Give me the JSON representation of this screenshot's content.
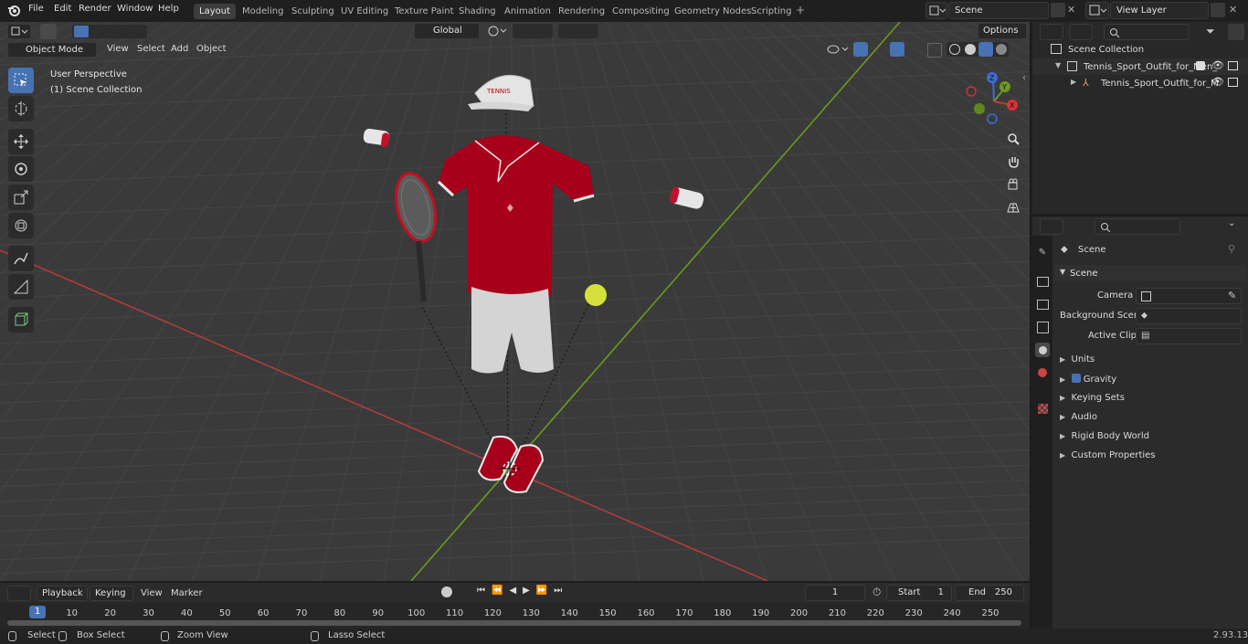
{
  "app": {
    "name": "Blender",
    "version": "2.93.13"
  },
  "menu": {
    "file": "File",
    "edit": "Edit",
    "render": "Render",
    "window": "Window",
    "help": "Help"
  },
  "workspaces": [
    "Layout",
    "Modeling",
    "Sculpting",
    "UV Editing",
    "Texture Paint",
    "Shading",
    "Animation",
    "Rendering",
    "Compositing",
    "Geometry Nodes",
    "Scripting"
  ],
  "active_workspace": "Layout",
  "scene_field": "Scene",
  "view_layer_field": "View Layer",
  "viewport": {
    "mode": "Object Mode",
    "menus": {
      "view": "View",
      "select": "Select",
      "add": "Add",
      "object": "Object"
    },
    "transform_orientation": "Global",
    "options": "Options",
    "overlay_line1": "User Perspective",
    "overlay_line2": "(1) Scene Collection",
    "gizmo": {
      "z": "Z",
      "y": "Y",
      "x": "X"
    }
  },
  "outliner": {
    "root": "Scene Collection",
    "items": [
      {
        "label": "Tennis_Sport_Outfit_for_Men_",
        "level": 1
      },
      {
        "label": "Tennis_Sport_Outfit_for_M",
        "level": 2
      }
    ]
  },
  "properties": {
    "context": "Scene",
    "panel": "Scene",
    "camera_label": "Camera",
    "background_scene_label": "Background Scene",
    "active_clip_label": "Active Clip",
    "sections": [
      "Units",
      "Gravity",
      "Keying Sets",
      "Audio",
      "Rigid Body World",
      "Custom Properties"
    ],
    "gravity_enabled": true
  },
  "timeline": {
    "menus": {
      "playback": "Playback",
      "keying": "Keying",
      "view": "View",
      "marker": "Marker"
    },
    "current_frame": "1",
    "start_label": "Start",
    "start": "1",
    "end_label": "End",
    "end": "250",
    "ruler": [
      "1",
      "10",
      "20",
      "30",
      "40",
      "50",
      "60",
      "70",
      "80",
      "90",
      "100",
      "110",
      "120",
      "130",
      "140",
      "150",
      "160",
      "170",
      "180",
      "190",
      "200",
      "210",
      "220",
      "230",
      "240",
      "250"
    ]
  },
  "status": {
    "select": "Select",
    "box_select": "Box Select",
    "zoom_view": "Zoom View",
    "lasso_select": "Lasso Select",
    "version": "2.93.13"
  },
  "colors": {
    "accent": "#4772b3",
    "shirt": "#a8001a",
    "ball": "#d6e03b",
    "x_axis": "#c0392b",
    "y_axis": "#6a9a1f"
  }
}
